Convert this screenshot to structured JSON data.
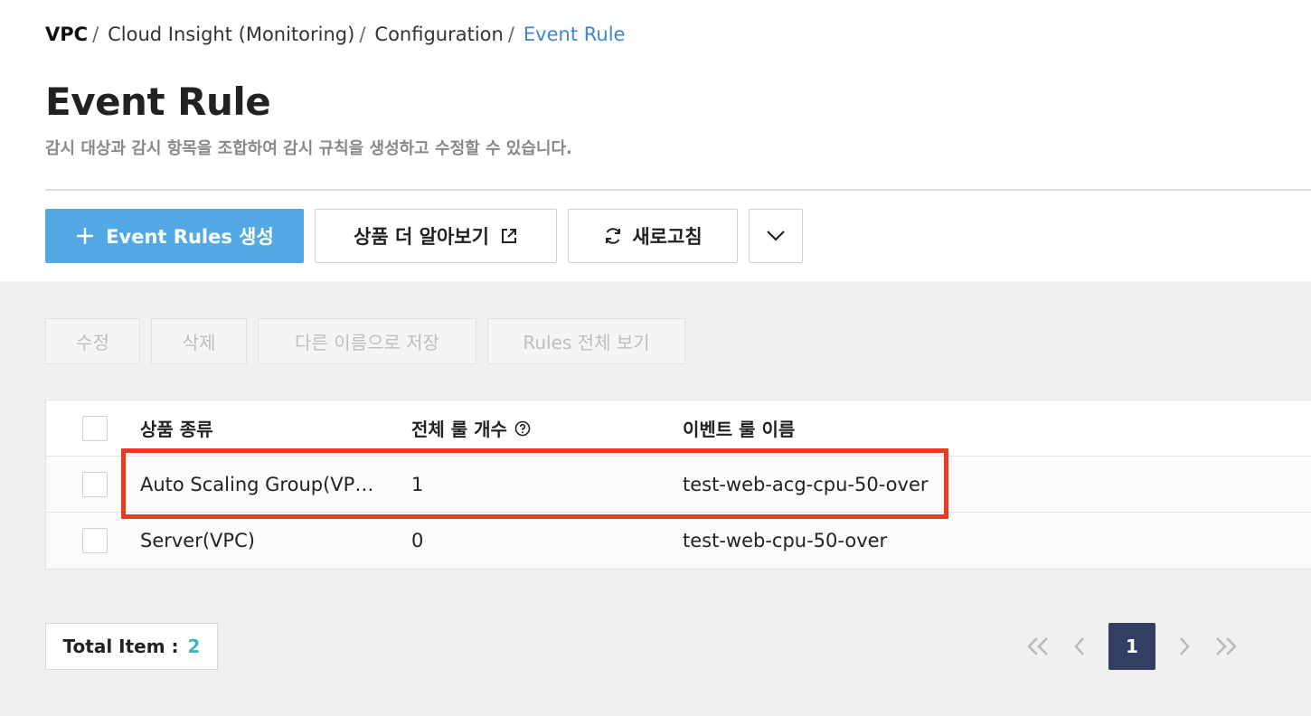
{
  "breadcrumb": {
    "items": [
      "VPC",
      "Cloud Insight (Monitoring)",
      "Configuration",
      "Event Rule"
    ],
    "separator": "/"
  },
  "header": {
    "title": "Event Rule",
    "description": "감시 대상과 감시 항목을 조합하여 감시 규칙을 생성하고 수정할 수 있습니다."
  },
  "toolbar": {
    "create_label": "Event Rules 생성",
    "learn_more_label": "상품 더 알아보기",
    "refresh_label": "새로고침"
  },
  "actions": {
    "edit": "수정",
    "delete": "삭제",
    "save_as": "다른 이름으로 저장",
    "view_all": "Rules 전체 보기"
  },
  "table": {
    "columns": [
      "상품 종류",
      "전체 룰 개수",
      "이벤트 룰 이름"
    ],
    "rows": [
      {
        "type": "Auto Scaling Group(VP…",
        "count": "1",
        "name": "test-web-acg-cpu-50-over"
      },
      {
        "type": "Server(VPC)",
        "count": "0",
        "name": "test-web-cpu-50-over"
      }
    ]
  },
  "footer": {
    "total_label": "Total Item :",
    "total_count": "2"
  },
  "pagination": {
    "current_page": "1"
  },
  "colors": {
    "primary": "#52a9e4",
    "breadcrumb_current": "#3d86d6",
    "highlight": "#e53a23",
    "total_count": "#3fb3c6",
    "page_active": "#323e62"
  }
}
